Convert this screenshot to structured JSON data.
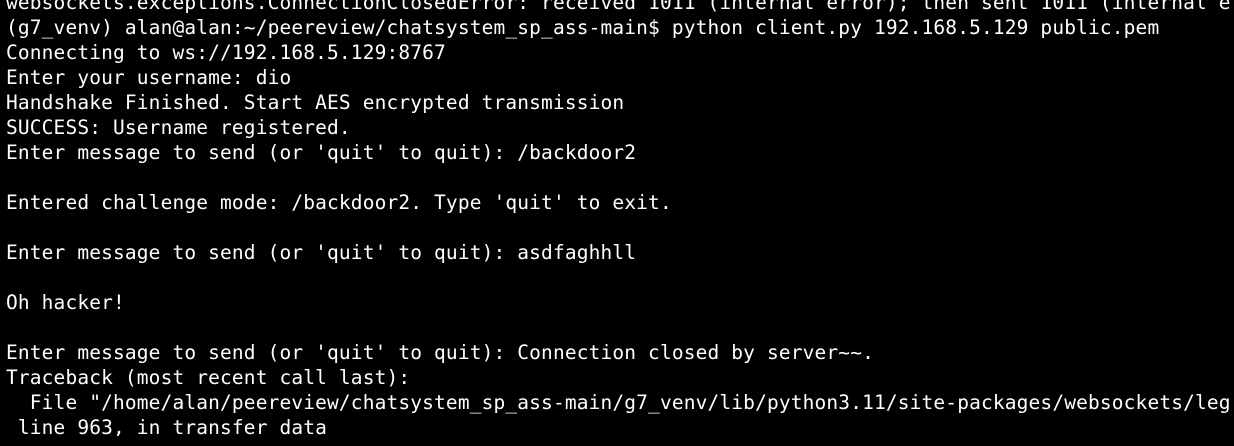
{
  "terminal": {
    "background": "#000000",
    "foreground": "#FFFFFF",
    "lines": [
      "websockets.exceptions.ConnectionClosedError: received 1011 (internal error); then sent 1011 (internal e",
      "(g7_venv) alan@alan:~/peereview/chatsystem_sp_ass-main$ python client.py 192.168.5.129 public.pem",
      "Connecting to ws://192.168.5.129:8767",
      "Enter your username: dio",
      "Handshake Finished. Start AES encrypted transmission",
      "SUCCESS: Username registered.",
      "Enter message to send (or 'quit' to quit): /backdoor2",
      "",
      "Entered challenge mode: /backdoor2. Type 'quit' to exit.",
      "",
      "Enter message to send (or 'quit' to quit): asdfaghhll",
      "",
      "Oh hacker!",
      "",
      "Enter message to send (or 'quit' to quit): Connection closed by server~~.",
      "Traceback (most recent call last):",
      "  File \"/home/alan/peereview/chatsystem_sp_ass-main/g7_venv/lib/python3.11/site-packages/websockets/leg",
      " line 963, in transfer_data"
    ]
  }
}
